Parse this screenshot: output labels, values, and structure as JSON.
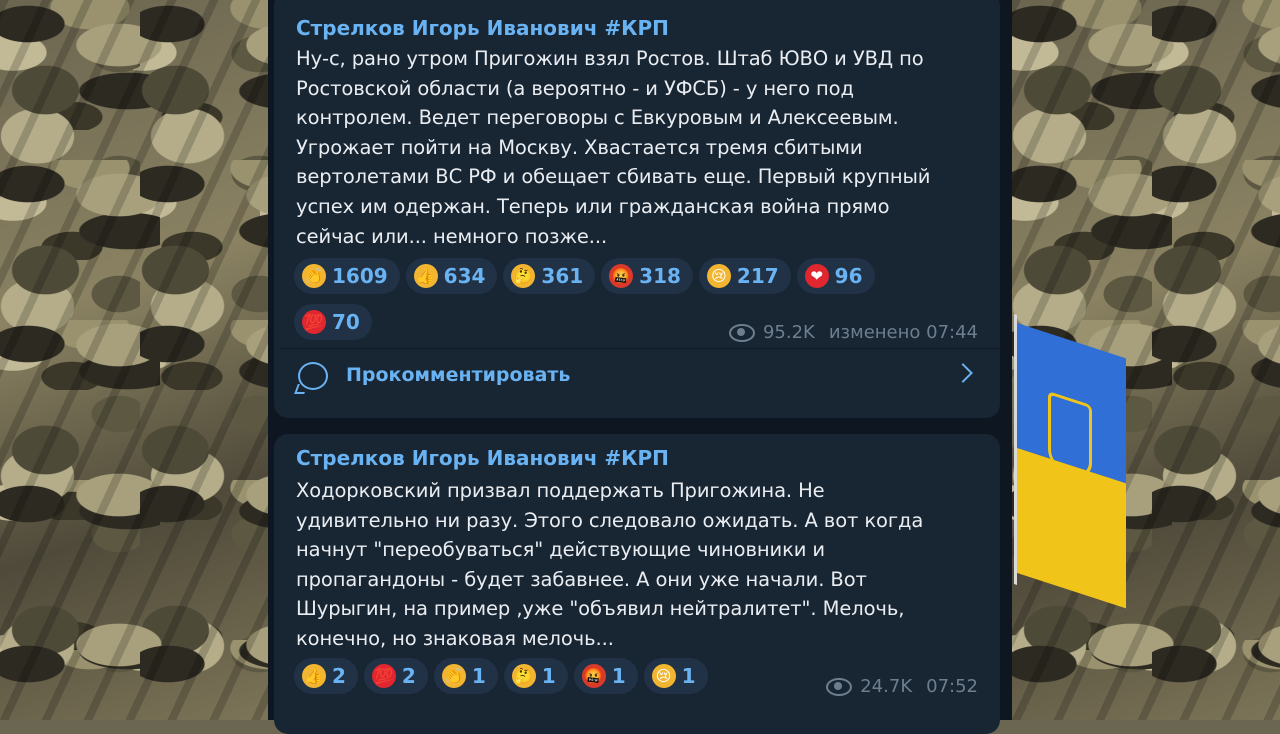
{
  "posts": [
    {
      "author": "Стрелков Игорь Иванович #КРП",
      "lines": [
        "Ну-с, рано утром Пригожин взял Ростов. Штаб ЮВО и УВД по",
        "Ростовской области (а вероятно - и УФСБ) - у него под",
        "контролем. Ведет переговоры с Евкуровым и Алексеевым.",
        "Угрожает пойти на Москву. Хвастается тремя сбитыми",
        "вертолетами ВС РФ и обещает сбивать еще. Первый крупный",
        "успех им одержан. Теперь или гражданская война прямо",
        "сейчас или... немного позже..."
      ],
      "reactions": [
        {
          "icon": "clap-emoji",
          "glyph": "👏",
          "color": "#f2b532",
          "count": "1609"
        },
        {
          "icon": "thumbs-up-emoji",
          "glyph": "👍",
          "color": "#f2b532",
          "count": "634"
        },
        {
          "icon": "thinking-face-emoji",
          "glyph": "🤔",
          "color": "#f2b532",
          "count": "361"
        },
        {
          "icon": "angry-face-emoji",
          "glyph": "🤬",
          "color": "#d83a2c",
          "count": "318"
        },
        {
          "icon": "crying-face-emoji",
          "glyph": "😢",
          "color": "#f2b532",
          "count": "217"
        },
        {
          "icon": "heart-emoji",
          "glyph": "❤",
          "color": "#e0262e",
          "count": "96"
        },
        {
          "icon": "hundred-points-emoji",
          "glyph": "💯",
          "color": "#e0262e",
          "count": "70"
        }
      ],
      "views": "95.2K",
      "time": "изменено 07:44",
      "comment_label": "Прокомментировать"
    },
    {
      "author": "Стрелков Игорь Иванович #КРП",
      "lines": [
        "Ходорковский призвал поддержать Пригожина. Не",
        "удивительно ни разу. Этого следовало ожидать. А вот когда",
        "начнут \"переобуваться\" действующие чиновники и",
        "пропагандоны - будет забавнее. А они уже начали. Вот",
        "Шурыгин, на пример ,уже \"объявил нейтралитет\".  Мелочь,",
        "конечно, но знаковая мелочь..."
      ],
      "reactions": [
        {
          "icon": "thumbs-up-emoji",
          "glyph": "👍",
          "color": "#f2b532",
          "count": "2"
        },
        {
          "icon": "hundred-points-emoji",
          "glyph": "💯",
          "color": "#e0262e",
          "count": "2"
        },
        {
          "icon": "clap-emoji",
          "glyph": "👏",
          "color": "#f2b532",
          "count": "1"
        },
        {
          "icon": "thinking-face-emoji",
          "glyph": "🤔",
          "color": "#f2b532",
          "count": "1"
        },
        {
          "icon": "angry-face-emoji",
          "glyph": "🤬",
          "color": "#d83a2c",
          "count": "1"
        },
        {
          "icon": "crying-face-emoji",
          "glyph": "😢",
          "color": "#f2b532",
          "count": "1"
        }
      ],
      "views": "24.7K",
      "time": "07:52"
    }
  ],
  "theme": {
    "accent": "#6ab3f3",
    "bubble": "#182533",
    "background": "#0e1621"
  }
}
